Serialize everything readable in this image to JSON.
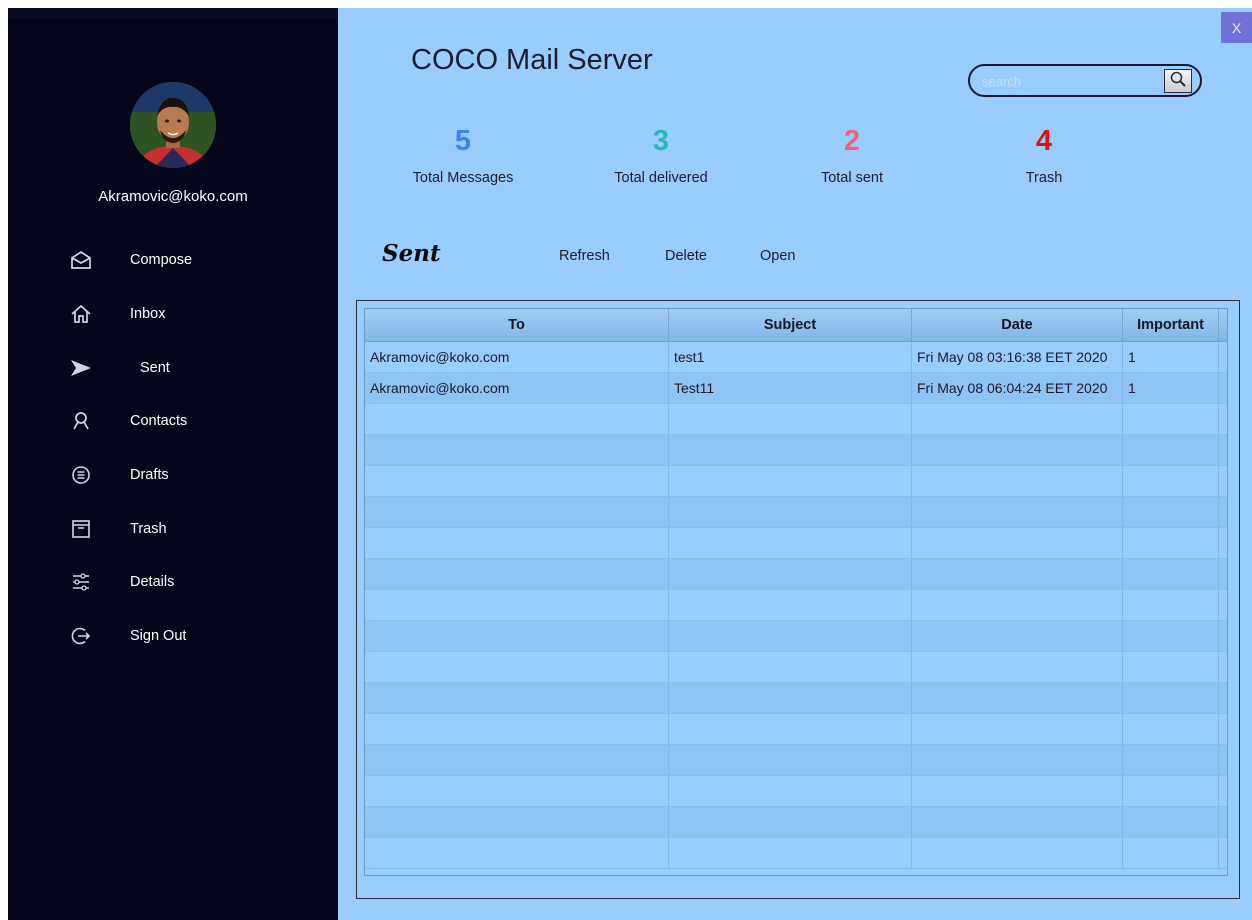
{
  "app": {
    "title": "COCO Mail Server",
    "close_label": "X"
  },
  "user": {
    "email": "Akramovic@koko.com"
  },
  "nav": [
    {
      "label": "Compose",
      "icon": "mail-open-icon"
    },
    {
      "label": "Inbox",
      "icon": "home-icon"
    },
    {
      "label": "Sent",
      "icon": "send-icon"
    },
    {
      "label": "Contacts",
      "icon": "contact-icon"
    },
    {
      "label": "Drafts",
      "icon": "list-circle-icon"
    },
    {
      "label": "Trash",
      "icon": "archive-box-icon"
    },
    {
      "label": "Details",
      "icon": "sliders-icon"
    },
    {
      "label": "Sign Out",
      "icon": "sign-out-icon"
    }
  ],
  "search": {
    "placeholder": "search"
  },
  "stats": [
    {
      "value": "5",
      "caption": "Total Messages",
      "color": "#3b82f6"
    },
    {
      "value": "3",
      "caption": "Total delivered",
      "color": "#2bb5b5"
    },
    {
      "value": "2",
      "caption": "Total sent",
      "color": "#f0607a"
    },
    {
      "value": "4",
      "caption": "Trash",
      "color": "#e01010"
    }
  ],
  "toolbar": {
    "section_title": "Sent",
    "refresh": "Refresh",
    "delete": "Delete",
    "open": "Open"
  },
  "table": {
    "columns": [
      "To",
      "Subject",
      "Date",
      "Important"
    ],
    "rows": [
      [
        "Akramovic@koko.com",
        "test1",
        "Fri May 08 03:16:38 EET 2020",
        "1"
      ],
      [
        "Akramovic@koko.com",
        "Test11",
        "Fri May 08 06:04:24 EET 2020",
        "1"
      ]
    ]
  },
  "colors": {
    "sidebar": "#05061a",
    "main": "#99ccff",
    "close_button": "#6f72d9"
  }
}
